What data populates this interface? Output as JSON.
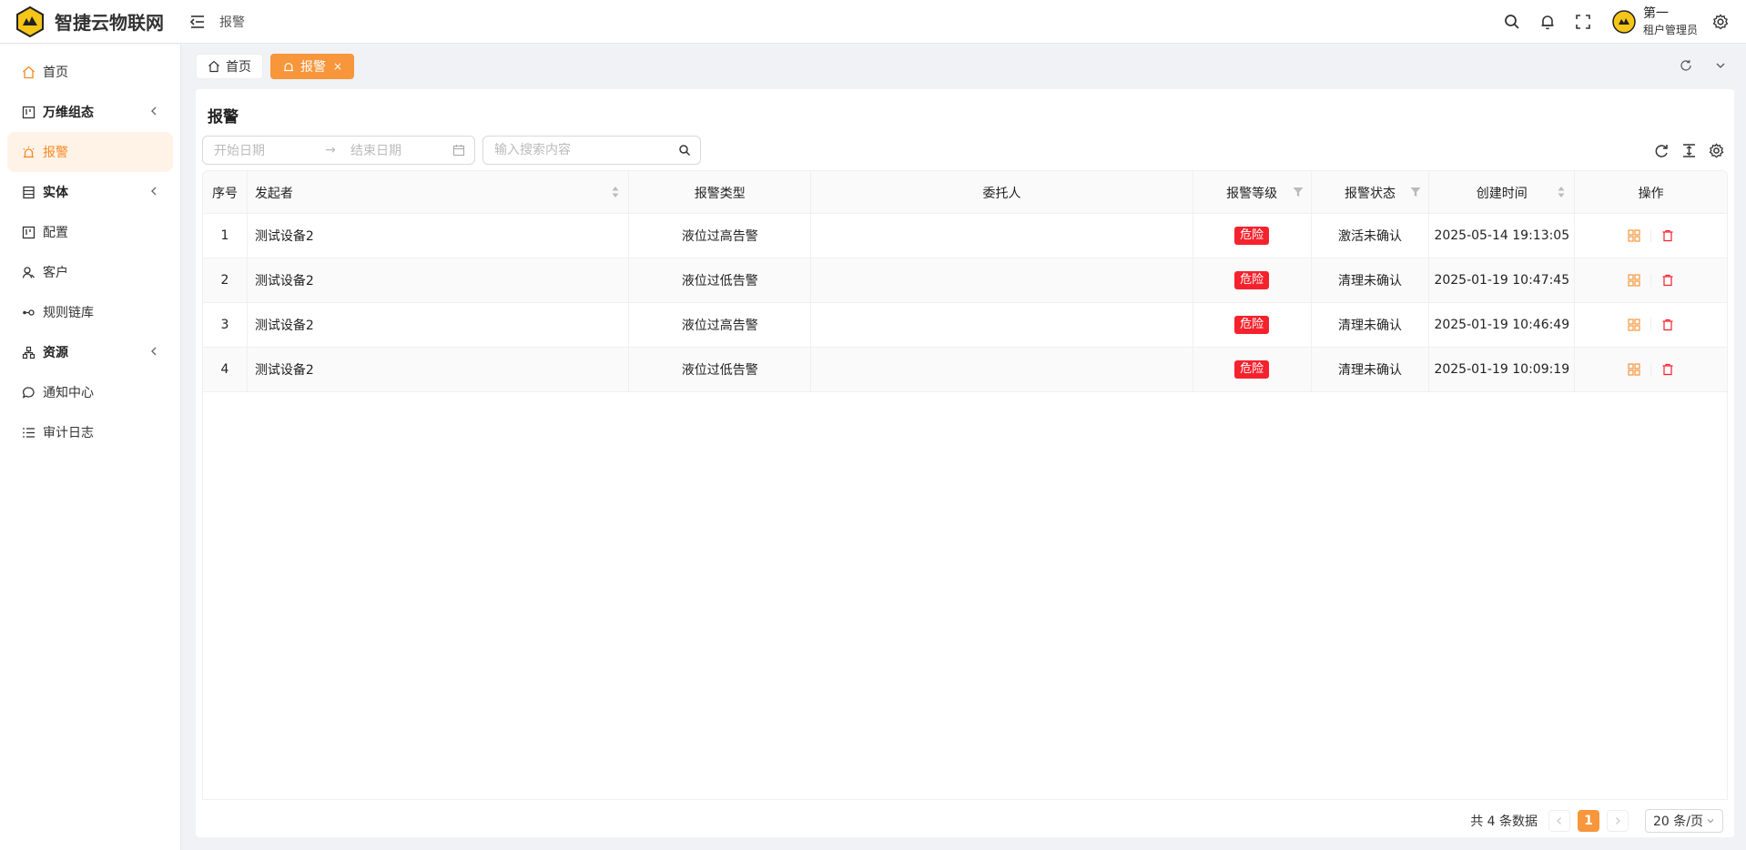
{
  "header": {
    "brand": "智捷云物联网",
    "breadcrumb": "报警",
    "user": {
      "name": "第一",
      "role": "租户管理员"
    }
  },
  "sidebar": {
    "items": [
      {
        "label": "首页",
        "icon": "home-icon"
      },
      {
        "label": "万维组态",
        "icon": "dashboard-icon",
        "expandable": true
      },
      {
        "label": "报警",
        "icon": "alarm-icon",
        "active": true
      },
      {
        "label": "实体",
        "icon": "entity-icon",
        "expandable": true
      },
      {
        "label": "配置",
        "icon": "config-icon"
      },
      {
        "label": "客户",
        "icon": "customer-icon"
      },
      {
        "label": "规则链库",
        "icon": "rule-chain-icon"
      },
      {
        "label": "资源",
        "icon": "resource-icon",
        "expandable": true
      },
      {
        "label": "通知中心",
        "icon": "notification-icon"
      },
      {
        "label": "审计日志",
        "icon": "audit-log-icon"
      }
    ]
  },
  "tabs": [
    {
      "label": "首页",
      "active": false
    },
    {
      "label": "报警",
      "active": true,
      "close": "×"
    }
  ],
  "page": {
    "title": "报警",
    "date_start_placeholder": "开始日期",
    "date_end_placeholder": "结束日期",
    "date_separator": "→",
    "search_placeholder": "输入搜索内容"
  },
  "table": {
    "columns": [
      "序号",
      "发起者",
      "报警类型",
      "委托人",
      "报警等级",
      "报警状态",
      "创建时间",
      "操作"
    ],
    "rows": [
      {
        "index": "1",
        "originator": "测试设备2",
        "type": "液位过高告警",
        "assignee": "",
        "severity": "危险",
        "status": "激活未确认",
        "created": "2025-05-14 19:13:05"
      },
      {
        "index": "2",
        "originator": "测试设备2",
        "type": "液位过低告警",
        "assignee": "",
        "severity": "危险",
        "status": "清理未确认",
        "created": "2025-01-19 10:47:45"
      },
      {
        "index": "3",
        "originator": "测试设备2",
        "type": "液位过高告警",
        "assignee": "",
        "severity": "危险",
        "status": "清理未确认",
        "created": "2025-01-19 10:46:49"
      },
      {
        "index": "4",
        "originator": "测试设备2",
        "type": "液位过低告警",
        "assignee": "",
        "severity": "危险",
        "status": "清理未确认",
        "created": "2025-01-19 10:09:19"
      }
    ]
  },
  "pagination": {
    "total_text": "共 4 条数据",
    "current_page": "1",
    "page_size": "20 条/页"
  },
  "colors": {
    "accent": "#f7963b",
    "danger": "#f5222d"
  }
}
